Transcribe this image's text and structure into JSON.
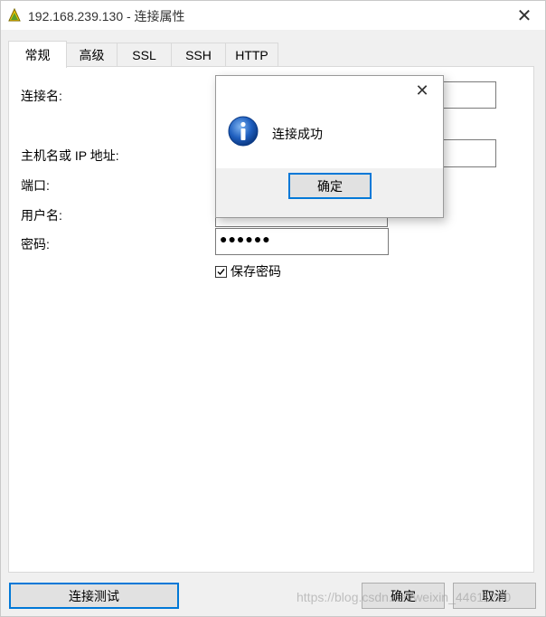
{
  "window": {
    "title": "192.168.239.130 - 连接属性",
    "close_glyph": "✕"
  },
  "tabs": [
    "常规",
    "高级",
    "SSL",
    "SSH",
    "HTTP"
  ],
  "form": {
    "connection_name_label": "连接名:",
    "host_label": "主机名或 IP 地址:",
    "port_label": "端口:",
    "username_label": "用户名:",
    "password_label": "密码:",
    "password_value": "●●●●●●",
    "save_password_label": "保存密码",
    "save_password_checked": true
  },
  "buttons": {
    "test_connection": "连接测试",
    "ok": "确定",
    "cancel": "取消"
  },
  "watermark": "https://blog.csdn.net/weixin_44611280",
  "dialog": {
    "message": "连接成功",
    "ok_label": "确定",
    "close_glyph": "✕"
  },
  "colors": {
    "focus_border": "#0078d7",
    "info_icon": "#1f5fbf"
  }
}
